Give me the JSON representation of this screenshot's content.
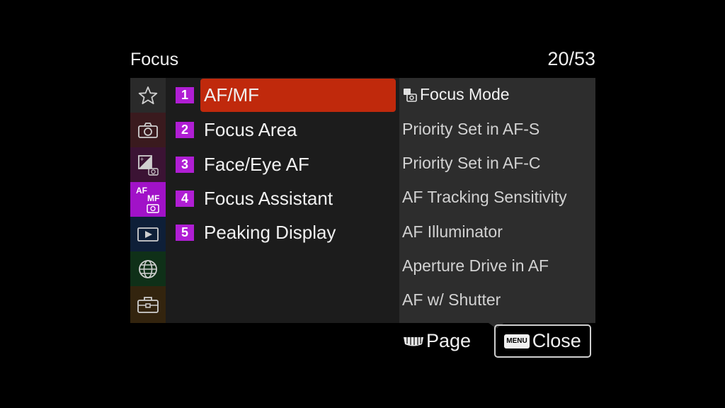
{
  "header": {
    "title": "Focus",
    "page_indicator": "20/53"
  },
  "tabs": [
    {
      "name": "my-menu",
      "icon": "star-icon",
      "color": "#2a2a2a"
    },
    {
      "name": "shooting",
      "icon": "camera-icon",
      "color": "#3a1a1e"
    },
    {
      "name": "exposure-color",
      "icon": "exposure-icon",
      "color": "#3b1334"
    },
    {
      "name": "focus",
      "icon": "af-mf-icon",
      "color": "#a112c8",
      "active": true
    },
    {
      "name": "playback",
      "icon": "playback-icon",
      "color": "#0e1f38"
    },
    {
      "name": "network",
      "icon": "globe-icon",
      "color": "#0f3018"
    },
    {
      "name": "setup",
      "icon": "toolbox-icon",
      "color": "#33240e"
    }
  ],
  "tab_af_label": "AF",
  "tab_mf_label": "MF",
  "items": [
    {
      "num": "1",
      "label": "AF/MF",
      "selected": true
    },
    {
      "num": "2",
      "label": "Focus Area"
    },
    {
      "num": "3",
      "label": "Face/Eye AF"
    },
    {
      "num": "4",
      "label": "Focus Assistant"
    },
    {
      "num": "5",
      "label": "Peaking Display"
    }
  ],
  "detail": [
    "Focus Mode",
    "Priority Set in AF-S",
    "Priority Set in AF-C",
    "AF Tracking Sensitivity",
    "AF Illuminator",
    "Aperture Drive in AF",
    "AF w/ Shutter"
  ],
  "footer": {
    "page_label": "Page",
    "menu_key": "MENU",
    "close_label": "Close"
  },
  "colors": {
    "accent_selected": "#c0290c",
    "number_badge": "#b01ed4",
    "active_tab": "#a112c8"
  }
}
